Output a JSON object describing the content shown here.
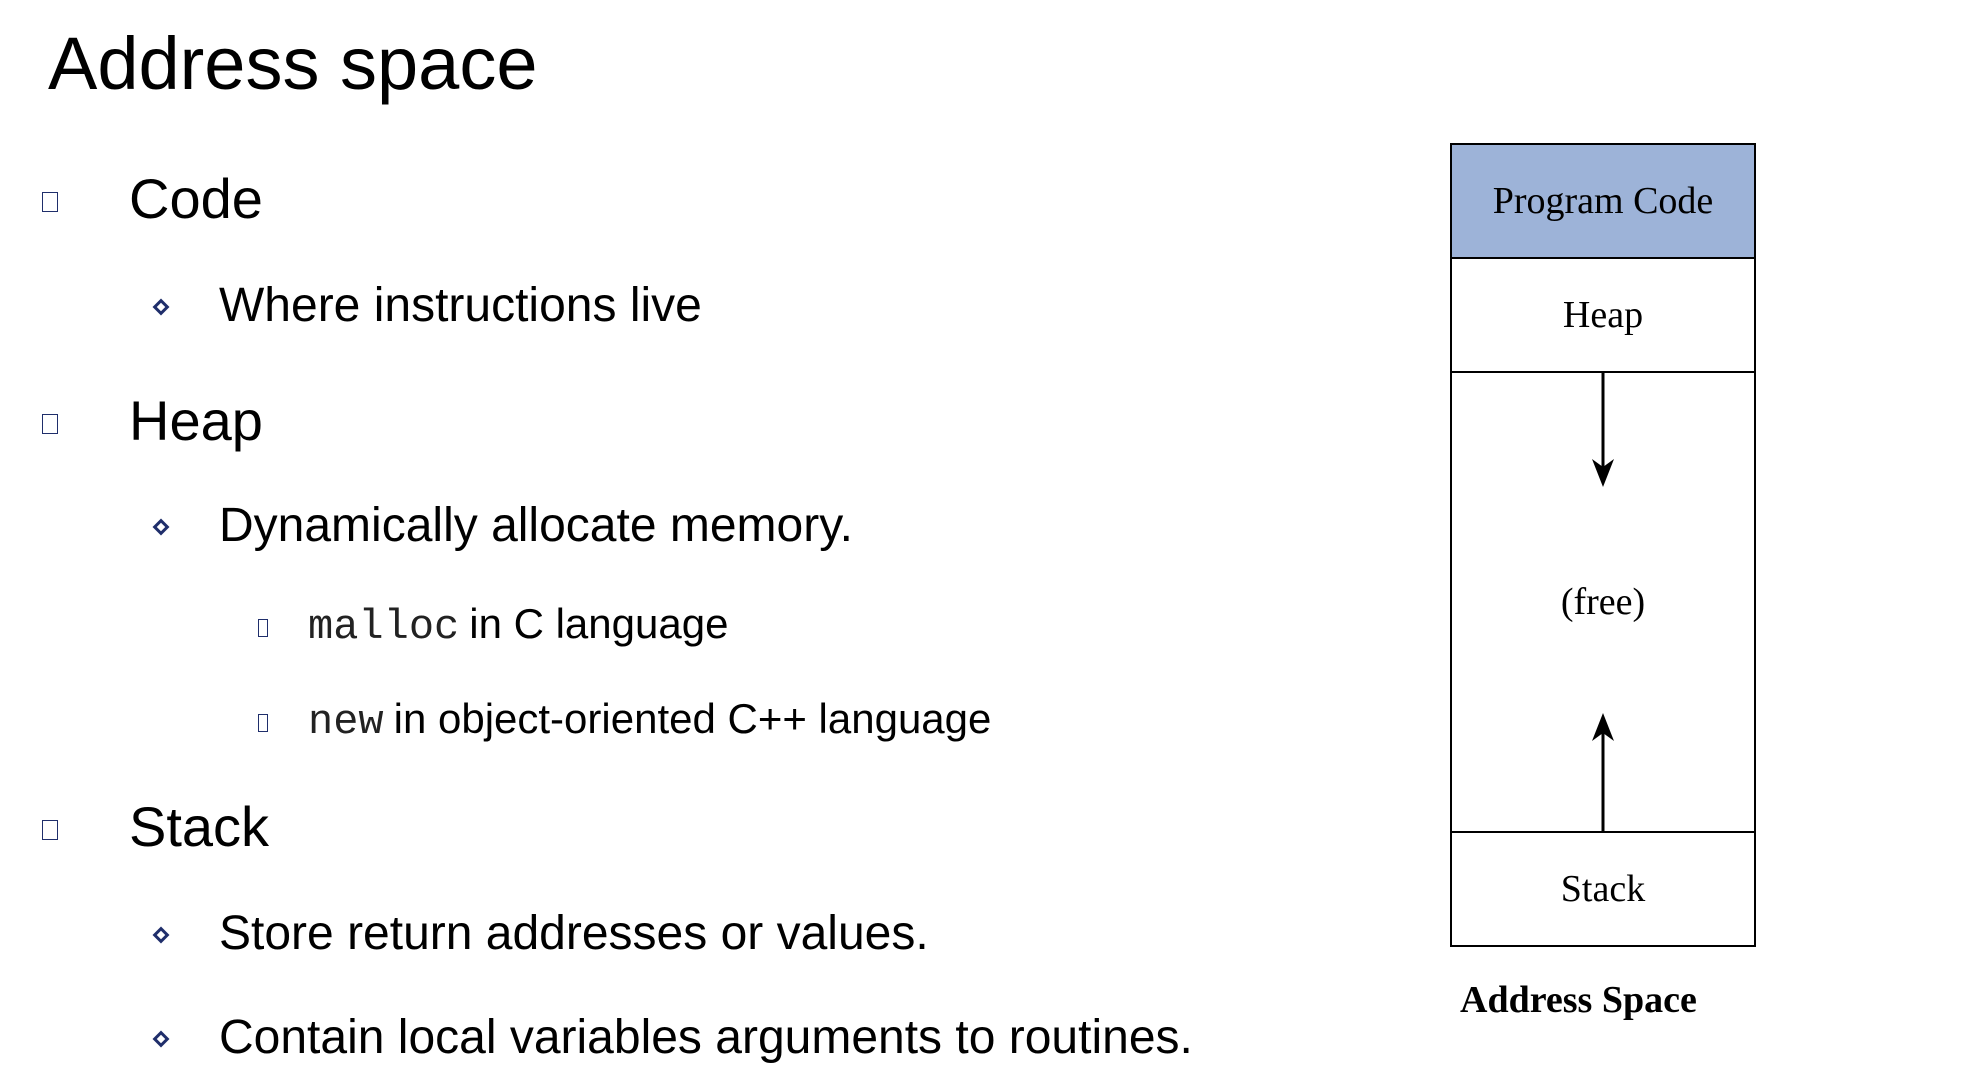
{
  "title": "Address space",
  "bullets": {
    "code": {
      "label": "Code",
      "sub": [
        "Where instructions live"
      ]
    },
    "heap": {
      "label": "Heap",
      "sub": [
        "Dynamically allocate memory."
      ],
      "subsub": [
        {
          "code": "malloc",
          "text": "in C language"
        },
        {
          "code": "new",
          "text": "in object-oriented C++ language"
        }
      ]
    },
    "stack": {
      "label": "Stack",
      "sub": [
        "Store return addresses or values.",
        "Contain local variables arguments to routines."
      ]
    }
  },
  "diagram": {
    "segments": {
      "code": "Program Code",
      "heap": "Heap",
      "free": "(free)",
      "stack": "Stack"
    },
    "caption": "Address Space",
    "colors": {
      "code_fill": "#9db3d8",
      "bullet": "#1f2e6b"
    }
  }
}
